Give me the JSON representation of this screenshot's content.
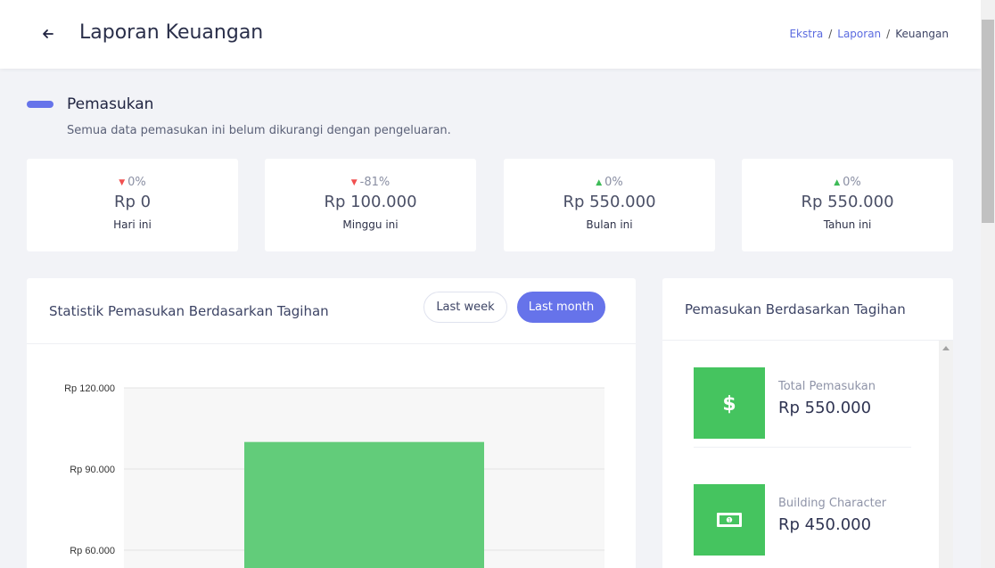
{
  "header": {
    "title": "Laporan Keuangan",
    "breadcrumb": [
      "Ekstra",
      "Laporan",
      "Keuangan"
    ]
  },
  "section": {
    "title": "Pemasukan",
    "subtitle": "Semua data pemasukan ini belum dikurangi dengan pengeluaran."
  },
  "stats": [
    {
      "change": "0%",
      "trend": "down",
      "value": "Rp 0",
      "label": "Hari ini"
    },
    {
      "change": "-81%",
      "trend": "down",
      "value": "Rp 100.000",
      "label": "Minggu ini"
    },
    {
      "change": "0%",
      "trend": "up",
      "value": "Rp 550.000",
      "label": "Bulan ini"
    },
    {
      "change": "0%",
      "trend": "up",
      "value": "Rp 550.000",
      "label": "Tahun ini"
    }
  ],
  "chart_card": {
    "title": "Statistik Pemasukan Berdasarkan Tagihan",
    "buttons": {
      "week": "Last week",
      "month": "Last month"
    }
  },
  "chart_data": {
    "type": "bar",
    "y_ticks": [
      "Rp 120.000",
      "Rp 90.000",
      "Rp 60.000"
    ],
    "ylim_visible": [
      60000,
      120000
    ],
    "values": [
      100000
    ],
    "bar_color": "#62cc7a"
  },
  "right_card": {
    "title": "Pemasukan Berdasarkan Tagihan",
    "items": [
      {
        "icon": "dollar-icon",
        "label": "Total Pemasukan",
        "value": "Rp 550.000"
      },
      {
        "icon": "banknote-icon",
        "label": "Building Character",
        "value": "Rp 450.000"
      }
    ]
  },
  "colors": {
    "accent": "#6673ea",
    "green": "#45c45f",
    "down": "#f15050",
    "up": "#3dbb57"
  }
}
